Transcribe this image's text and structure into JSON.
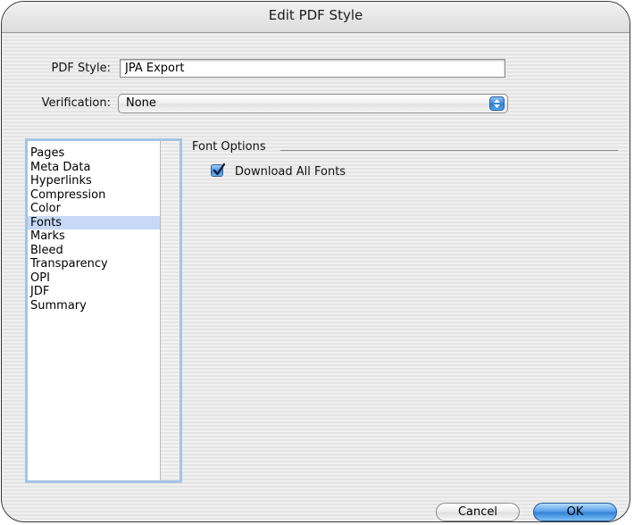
{
  "window": {
    "title": "Edit PDF Style"
  },
  "form": {
    "pdf_style_label": "PDF Style:",
    "pdf_style_value": "JPA Export",
    "verification_label": "Verification:",
    "verification_value": "None"
  },
  "sidebar": {
    "items": [
      {
        "label": "Pages"
      },
      {
        "label": "Meta Data"
      },
      {
        "label": "Hyperlinks"
      },
      {
        "label": "Compression"
      },
      {
        "label": "Color"
      },
      {
        "label": "Fonts",
        "selected": true
      },
      {
        "label": "Marks"
      },
      {
        "label": "Bleed"
      },
      {
        "label": "Transparency"
      },
      {
        "label": "OPI"
      },
      {
        "label": "JDF"
      },
      {
        "label": "Summary"
      }
    ]
  },
  "font_options": {
    "group_title": "Font Options",
    "download_all_fonts_label": "Download All Fonts",
    "download_all_fonts_checked": true
  },
  "buttons": {
    "cancel_label": "Cancel",
    "ok_label": "OK"
  },
  "colors": {
    "selection": "#c6d8f4",
    "accent": "#3e8ee0"
  },
  "icons": {
    "popup_arrows": "updown-arrows-icon",
    "checkmark": "checkmark-icon"
  }
}
